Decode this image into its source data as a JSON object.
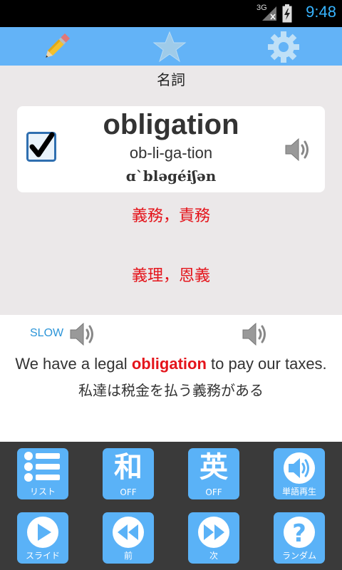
{
  "status_bar": {
    "network": "3G",
    "time": "9:48",
    "icons": [
      "signal-icon",
      "battery-charging-icon"
    ]
  },
  "toolbar": {
    "items": [
      {
        "name": "edit",
        "icon": "pencil-icon"
      },
      {
        "name": "favorite",
        "icon": "star-icon"
      },
      {
        "name": "settings",
        "icon": "gear-icon"
      }
    ],
    "accent": "#63b3f7"
  },
  "word_card": {
    "part_of_speech": "名詞",
    "word": "obligation",
    "syllables": "ob-li-ga-tion",
    "pronunciation": "ɑ`bləgéiʃən",
    "checked": true,
    "meanings": [
      "義務，責務",
      "義理，恩義"
    ],
    "meaning_color": "#e4141b"
  },
  "example": {
    "slow_label": "SLOW",
    "sentence_before": "We have a legal ",
    "sentence_highlight": "obligation",
    "sentence_after": " to pay our taxes.",
    "translation": "私達は税金を払う義務がある"
  },
  "bottom_buttons": [
    {
      "name": "list",
      "icon": "list-icon",
      "caption": "リスト"
    },
    {
      "name": "japanese",
      "glyph": "和",
      "caption": "OFF"
    },
    {
      "name": "english",
      "glyph": "英",
      "caption": "OFF"
    },
    {
      "name": "word-play",
      "icon": "speaker-icon",
      "caption": "単語再生"
    },
    {
      "name": "slide",
      "icon": "play-icon",
      "caption": "スライド"
    },
    {
      "name": "previous",
      "icon": "rewind-icon",
      "caption": "前"
    },
    {
      "name": "next",
      "icon": "fast-forward-icon",
      "caption": "次"
    },
    {
      "name": "random",
      "icon": "question-icon",
      "caption": "ランダム"
    }
  ]
}
